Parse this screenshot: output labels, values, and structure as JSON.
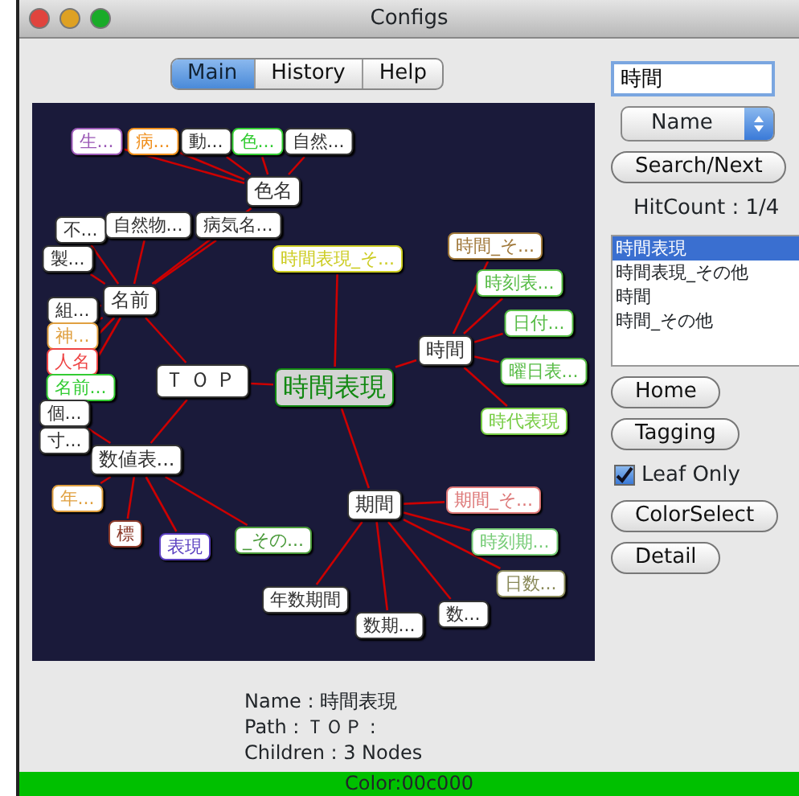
{
  "window": {
    "title": "Configs"
  },
  "tabs": [
    {
      "label": "Main",
      "selected": true
    },
    {
      "label": "History",
      "selected": false
    },
    {
      "label": "Help",
      "selected": false
    }
  ],
  "graph": {
    "root": {
      "label": "ＴＯＰ",
      "color": "#333333",
      "selected": false,
      "children": [
        {
          "label": "名前",
          "color": "#333333",
          "selected": false,
          "children": [
            {
              "label": "製...",
              "color": "#333333",
              "selected": false
            },
            {
              "label": "不...",
              "color": "#333333",
              "selected": false
            },
            {
              "label": "自然物...",
              "color": "#333333",
              "selected": false
            },
            {
              "label": "病気名...",
              "color": "#333333",
              "selected": false
            },
            {
              "label": "色名",
              "color": "#333333",
              "selected": false,
              "children": [
                {
                  "label": "生...",
                  "color": "#9b59b6",
                  "selected": false
                },
                {
                  "label": "病...",
                  "color": "#f0901e",
                  "selected": false
                },
                {
                  "label": "動...",
                  "color": "#333333",
                  "selected": false
                },
                {
                  "label": "色...",
                  "color": "#33cc33",
                  "selected": false
                },
                {
                  "label": "自然...",
                  "color": "#333333",
                  "selected": false
                }
              ]
            },
            {
              "label": "組...",
              "color": "#333333",
              "selected": false
            },
            {
              "label": "神...",
              "color": "#e0a040",
              "selected": false
            },
            {
              "label": "人名",
              "color": "#ee4444",
              "selected": false
            },
            {
              "label": "名前...",
              "color": "#33cc33",
              "selected": false
            }
          ]
        },
        {
          "label": "数値表...",
          "color": "#333333",
          "selected": false,
          "children": [
            {
              "label": "個...",
              "color": "#333333",
              "selected": false
            },
            {
              "label": "寸...",
              "color": "#333333",
              "selected": false
            },
            {
              "label": "年...",
              "color": "#e0a040",
              "selected": false
            },
            {
              "label": "標",
              "color": "#8b3a2a",
              "selected": false
            },
            {
              "label": "表現",
              "color": "#5a3fc0",
              "selected": false
            },
            {
              "label": "_その...",
              "color": "#4a9a3a",
              "selected": false
            }
          ]
        },
        {
          "label": "時間表現",
          "color": "#118811",
          "selected": true,
          "children": [
            {
              "label": "時間表現_そ...",
              "color": "#cccc22",
              "selected": false
            },
            {
              "label": "時間",
              "color": "#333333",
              "selected": false,
              "children": [
                {
                  "label": "時間_そ...",
                  "color": "#a0783a",
                  "selected": false
                },
                {
                  "label": "時刻表...",
                  "color": "#55bb44",
                  "selected": false
                },
                {
                  "label": "日付...",
                  "color": "#55bb44",
                  "selected": false
                },
                {
                  "label": "曜日表...",
                  "color": "#55bb44",
                  "selected": false
                },
                {
                  "label": "時代表現",
                  "color": "#77cc44",
                  "selected": false
                }
              ]
            },
            {
              "label": "期間",
              "color": "#333333",
              "selected": false,
              "children": [
                {
                  "label": "期間_そ...",
                  "color": "#dd7777",
                  "selected": false
                },
                {
                  "label": "時刻期...",
                  "color": "#77cc77",
                  "selected": false
                },
                {
                  "label": "日数...",
                  "color": "#8a8a5a",
                  "selected": false
                },
                {
                  "label": "数...",
                  "color": "#333333",
                  "selected": false
                },
                {
                  "label": "数期...",
                  "color": "#333333",
                  "selected": false
                },
                {
                  "label": "年数期間",
                  "color": "#333333",
                  "selected": false
                }
              ]
            }
          ]
        }
      ]
    }
  },
  "search": {
    "value": "時間"
  },
  "search_mode": {
    "value": "Name"
  },
  "search_button": "Search/Next",
  "hit_count": "HitCount : 1/4",
  "results": [
    {
      "label": "時間表現",
      "selected": true
    },
    {
      "label": "時間表現_その他",
      "selected": false
    },
    {
      "label": "時間",
      "selected": false
    },
    {
      "label": "時間_その他",
      "selected": false
    }
  ],
  "buttons_top": [
    "Home",
    "Tagging"
  ],
  "leaf_only": {
    "label": "Leaf Only",
    "checked": true
  },
  "buttons_bottom": [
    "ColorSelect",
    "Detail"
  ],
  "info": [
    "Name : 時間表現",
    "Path : ＴＯＰ :",
    "Children : 3 Nodes"
  ],
  "status_bar": {
    "text": "Color:00c000",
    "color": "#00c000"
  }
}
